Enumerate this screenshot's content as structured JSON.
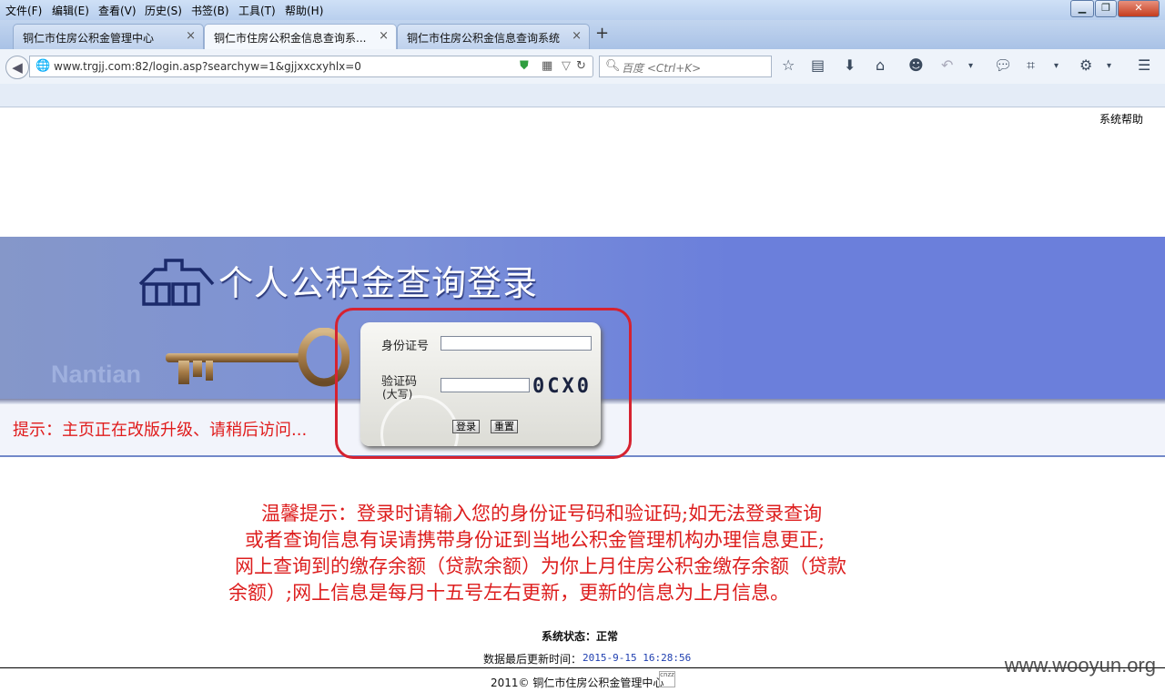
{
  "browser": {
    "menu": [
      "文件(F)",
      "编辑(E)",
      "查看(V)",
      "历史(S)",
      "书签(B)",
      "工具(T)",
      "帮助(H)"
    ],
    "tabs": [
      {
        "label": "铜仁市住房公积金管理中心",
        "close": "×"
      },
      {
        "label": "铜仁市住房公积金信息查询系...",
        "close": "×"
      },
      {
        "label": "铜仁市住房公积金信息查询系统",
        "close": "×"
      }
    ],
    "new_tab": "+",
    "url": "www.trgjj.com:82/login.asp?searchyw=1&gjjxxcxyhlx=0",
    "search_placeholder": "百度 <Ctrl+K>"
  },
  "page": {
    "help_link": "系统帮助",
    "banner_title": "个人公积金查询登录",
    "banner_brand": "Nantian",
    "hint": "提示：主页正在改版升级、请稍后访问...",
    "login": {
      "id_label": "身份证号",
      "captcha_label": "验证码",
      "captcha_sub": "(大写)",
      "captcha_code": "0CX0",
      "login_button": "登录",
      "reset_button": "重置"
    },
    "notice": [
      "温馨提示：登录时请输入您的身份证号码和验证码;如无法登录查询",
      "或者查询信息有误请携带身份证到当地公积金管理机构办理信息更正;",
      "网上查询到的缴存余额（贷款余额）为你上月住房公积金缴存余额（贷款",
      "余额）;网上信息是每月十五号左右更新，更新的信息为上月信息。"
    ],
    "system_status": "系统状态：正常",
    "last_update_label": "数据最后更新时间：",
    "last_update_time": "2015-9-15 16:28:56",
    "footer": "2011© 铜仁市住房公积金管理中心",
    "stats_badge": "cnzz",
    "watermark": "www.wooyun.org"
  },
  "colors": {
    "banner": "#6b7fdb",
    "notice_red": "#dd1e1e",
    "highlight_red": "#d62230"
  }
}
